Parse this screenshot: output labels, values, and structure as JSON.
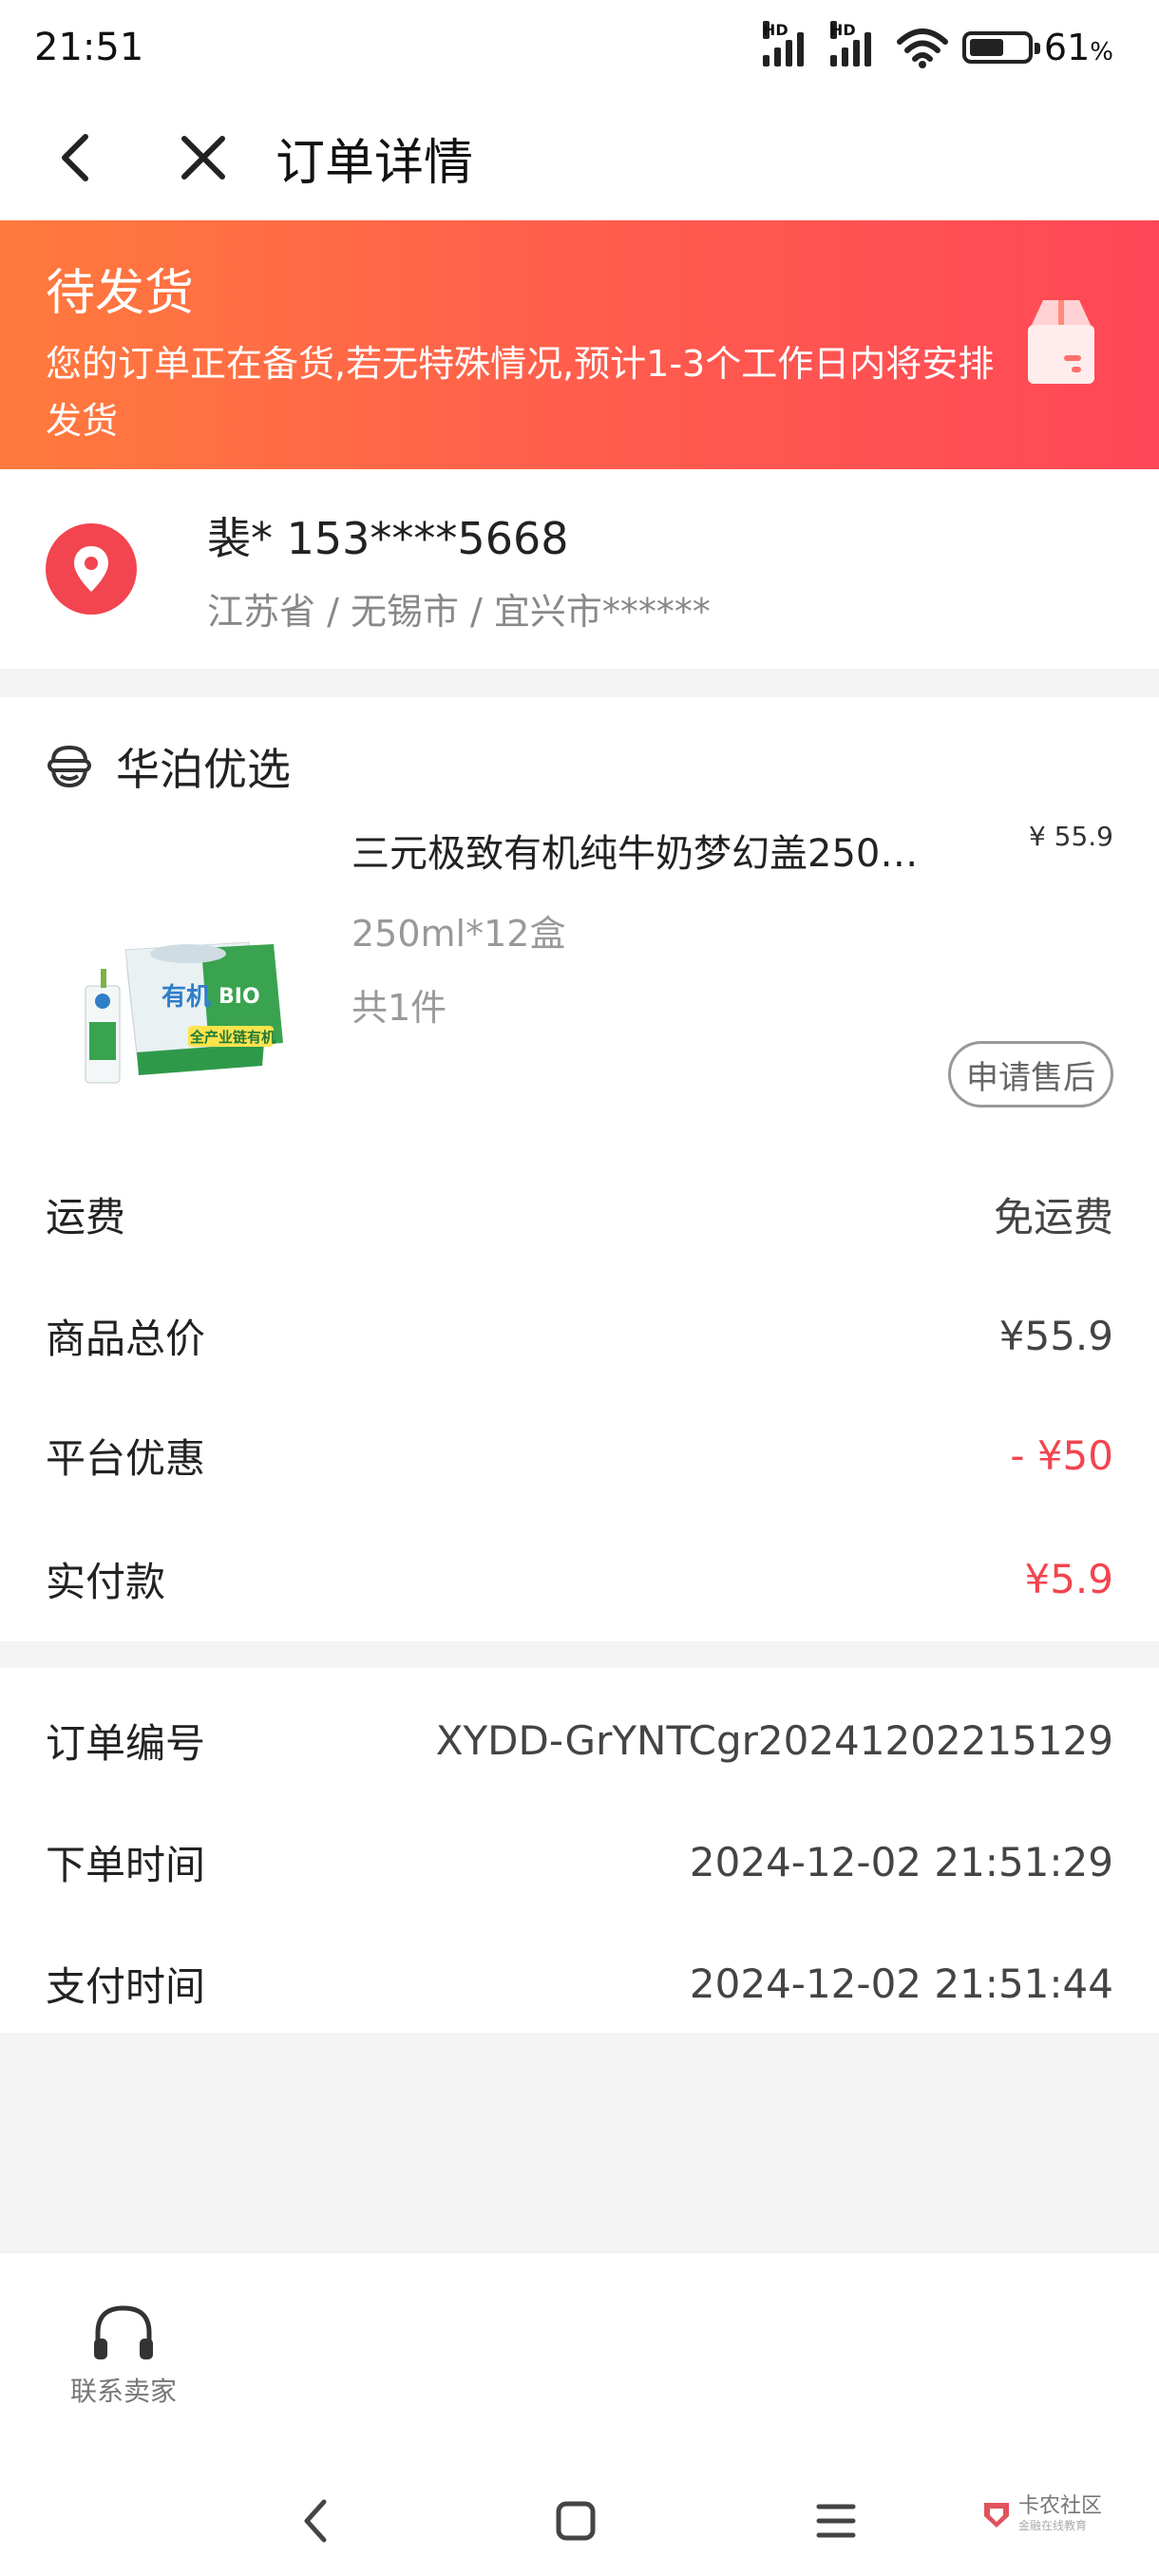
{
  "status_bar": {
    "time": "21:51",
    "network_label_1": "HD",
    "network_label_2": "HD",
    "battery_percent": "61",
    "battery_unit": "%"
  },
  "header": {
    "title": "订单详情"
  },
  "banner": {
    "title": "待发货",
    "description": "您的订单正在备货,若无特殊情况,预计1-3个工作日内将安排发货",
    "icon": "package-icon"
  },
  "address": {
    "name_phone": "裴* 153****5668",
    "location": "江苏省 / 无锡市 / 宜兴市******"
  },
  "shop": {
    "name": "华泊优选"
  },
  "product": {
    "title": "三元极致有机纯牛奶梦幻盖250…",
    "price": "¥ 55.9",
    "spec": "250ml*12盒",
    "quantity": "共1件",
    "after_sale_label": "申请售后",
    "image_caption_1": "有机",
    "image_caption_2": "BIO",
    "image_caption_3": "全产业链有机"
  },
  "fees": [
    {
      "label": "运费",
      "value": "免运费",
      "highlight": false
    },
    {
      "label": "商品总价",
      "value": "¥55.9",
      "highlight": false
    },
    {
      "label": "平台优惠",
      "value": "- ¥50",
      "highlight": true
    },
    {
      "label": "实付款",
      "value": "¥5.9",
      "highlight": true
    }
  ],
  "order_info": [
    {
      "label": "订单编号",
      "value": "XYDD-GrYNTCgr20241202215129"
    },
    {
      "label": "下单时间",
      "value": "2024-12-02 21:51:29"
    },
    {
      "label": "支付时间",
      "value": "2024-12-02 21:51:44"
    }
  ],
  "bottom": {
    "contact_label": "联系卖家"
  },
  "watermark": {
    "text": "卡农社区",
    "sub": "金融在线教育"
  },
  "colors": {
    "accent_red": "#f2454f",
    "banner_start": "#ff7a3d",
    "banner_end": "#ff4757"
  }
}
